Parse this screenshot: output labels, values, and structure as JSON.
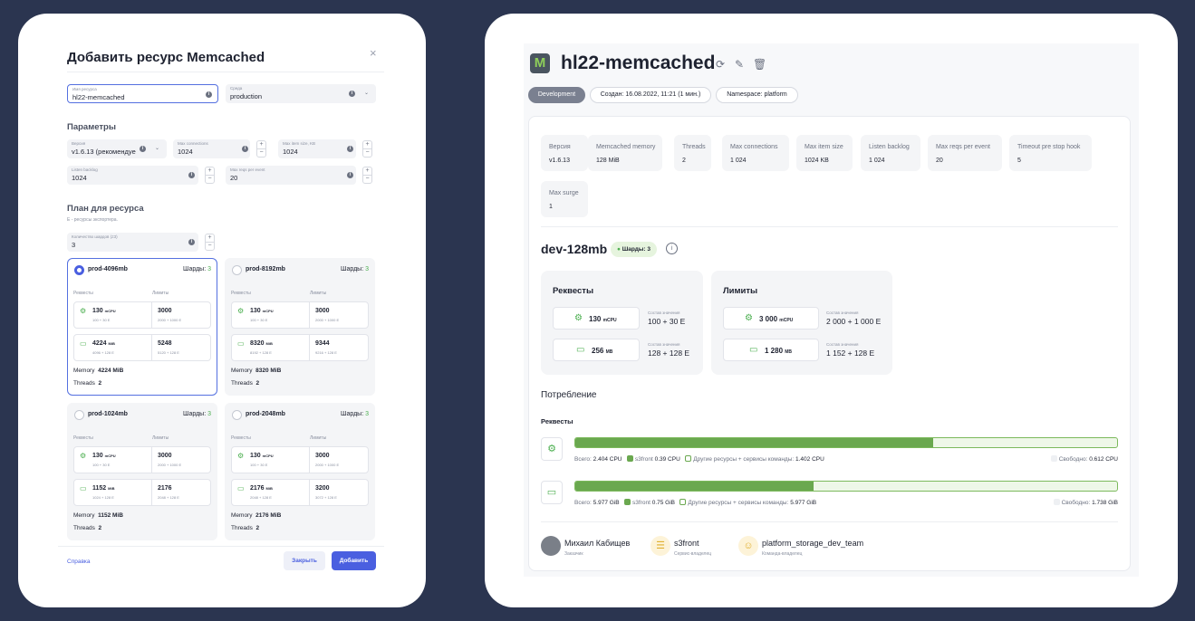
{
  "modal": {
    "title": "Добавить ресурс Memcached",
    "close": "×",
    "fields": {
      "name": {
        "label": "Имя ресурса",
        "value": "hl22-memcached"
      },
      "env": {
        "label": "Среда",
        "value": "production"
      }
    },
    "params_title": "Параметры",
    "params": {
      "version": {
        "label": "Версия",
        "value": "v1.6.13 (рекомендуе"
      },
      "max_connections": {
        "label": "Max connections",
        "value": "1024"
      },
      "max_item_size": {
        "label": "Max item size, KB",
        "value": "1024"
      },
      "listen_backlog": {
        "label": "Listen backlog",
        "value": "1024"
      },
      "max_reqs": {
        "label": "Max reqs per event",
        "value": "20"
      }
    },
    "plan_title": "План для ресурса",
    "plan_note": "E - ресурсы экспортера.",
    "shards_field": {
      "label": "Количество шардов (≠3)",
      "value": "3"
    },
    "plans": [
      {
        "name": "prod-4096mb",
        "shards_label": "Шарды:",
        "shards": "3",
        "selected": true,
        "requests_label": "Реквесты",
        "limits_label": "Лимиты",
        "cpu": {
          "req": "130",
          "req_unit": "mCPU",
          "req_sub": "100 + 30 E",
          "lim": "3000",
          "lim_sub": "2000 + 1000 E"
        },
        "mem": {
          "req": "4224",
          "req_unit": "MiB",
          "req_sub": "4096 + 128 E",
          "lim": "5248",
          "lim_sub": "5120 + 128 E"
        },
        "memory_label": "Memory",
        "memory": "4224 MiB",
        "threads_label": "Threads",
        "threads": "2"
      },
      {
        "name": "prod-8192mb",
        "shards_label": "Шарды:",
        "shards": "3",
        "selected": false,
        "requests_label": "Реквесты",
        "limits_label": "Лимиты",
        "cpu": {
          "req": "130",
          "req_unit": "mCPU",
          "req_sub": "100 + 30 E",
          "lim": "3000",
          "lim_sub": "2000 + 1000 E"
        },
        "mem": {
          "req": "8320",
          "req_unit": "MiB",
          "req_sub": "8192 + 128 E",
          "lim": "9344",
          "lim_sub": "9216 + 128 E"
        },
        "memory_label": "Memory",
        "memory": "8320 MiB",
        "threads_label": "Threads",
        "threads": "2"
      },
      {
        "name": "prod-1024mb",
        "shards_label": "Шарды:",
        "shards": "3",
        "selected": false,
        "requests_label": "Реквесты",
        "limits_label": "Лимиты",
        "cpu": {
          "req": "130",
          "req_unit": "mCPU",
          "req_sub": "100 + 30 E",
          "lim": "3000",
          "lim_sub": "2000 + 1000 E"
        },
        "mem": {
          "req": "1152",
          "req_unit": "MiB",
          "req_sub": "1024 + 128 E",
          "lim": "2176",
          "lim_sub": "2048 + 128 E"
        },
        "memory_label": "Memory",
        "memory": "1152 MiB",
        "threads_label": "Threads",
        "threads": "2"
      },
      {
        "name": "prod-2048mb",
        "shards_label": "Шарды:",
        "shards": "3",
        "selected": false,
        "requests_label": "Реквесты",
        "limits_label": "Лимиты",
        "cpu": {
          "req": "130",
          "req_unit": "mCPU",
          "req_sub": "100 + 30 E",
          "lim": "3000",
          "lim_sub": "2000 + 1000 E"
        },
        "mem": {
          "req": "2176",
          "req_unit": "MiB",
          "req_sub": "2048 + 128 E",
          "lim": "3200",
          "lim_sub": "3072 + 128 E"
        },
        "memory_label": "Memory",
        "memory": "2176 MiB",
        "threads_label": "Threads",
        "threads": "2"
      }
    ],
    "help_link": "Справка",
    "close_button": "Закрыть",
    "add_button": "Добавить"
  },
  "resource": {
    "title": "hl22-memcached",
    "logo": "M",
    "chips": {
      "env": "Development",
      "created": "Создан: 16.08.2022, 11:21 (1 мин.)",
      "namespace": "Namespace: platform"
    },
    "params": [
      {
        "label": "Версия",
        "value": "v1.6.13"
      },
      {
        "label": "Memcached memory",
        "value": "128 MiB"
      },
      {
        "label": "Threads",
        "value": "2"
      },
      {
        "label": "Max connections",
        "value": "1 024"
      },
      {
        "label": "Max item size",
        "value": "1024 KB"
      },
      {
        "label": "Listen backlog",
        "value": "1 024"
      },
      {
        "label": "Max reqs per event",
        "value": "20"
      },
      {
        "label": "Timeout pre stop hook",
        "value": "5"
      },
      {
        "label": "Max surge",
        "value": "1"
      }
    ],
    "plan_name": "dev-128mb",
    "plan_badge": "Шарды: 3",
    "requests": {
      "title": "Реквесты",
      "cpu": {
        "value": "130",
        "unit": "mCPU",
        "comp_label": "Состав значения",
        "comp": "100 + 30 E"
      },
      "mem": {
        "value": "256",
        "unit": "MB",
        "comp_label": "Состав значения",
        "comp": "128 + 128 E"
      }
    },
    "limits": {
      "title": "Лимиты",
      "cpu": {
        "value": "3 000",
        "unit": "mCPU",
        "comp_label": "Состав значения",
        "comp": "2 000 + 1 000 E"
      },
      "mem": {
        "value": "1 280",
        "unit": "MB",
        "comp_label": "Состав значения",
        "comp": "1 152 + 128 E"
      }
    },
    "consumption_title": "Потребление",
    "consumption_sub": "Реквесты",
    "usage": [
      {
        "kind": "cpu",
        "fill_fraction": 0.66,
        "total_label": "Всего:",
        "total": "2.404 CPU",
        "own_label": "s3front",
        "own": "0.39 CPU",
        "other_label": "Другие ресурсы + сервисы команды:",
        "other": "1.402 CPU",
        "free_label": "Свободно:",
        "free": "0.612 CPU"
      },
      {
        "kind": "mem",
        "fill_fraction": 0.44,
        "total_label": "Всего:",
        "total": "5.977 GiB",
        "own_label": "s3front",
        "own": "0.75 GiB",
        "other_label": "Другие ресурсы + сервисы команды:",
        "other": "5.977 GiB",
        "free_label": "Свободно:",
        "free": "1.738 GiB"
      }
    ],
    "owners": [
      {
        "name": "Михаил Кабищев",
        "role": "Заказчик"
      },
      {
        "name": "s3front",
        "role": "Сервис-владелец"
      },
      {
        "name": "platform_storage_dev_team",
        "role": "Команда-владелец"
      }
    ],
    "colors": {
      "accent": "#4a5fe0",
      "green": "#6aa84f",
      "bg": "#2b3550"
    }
  }
}
